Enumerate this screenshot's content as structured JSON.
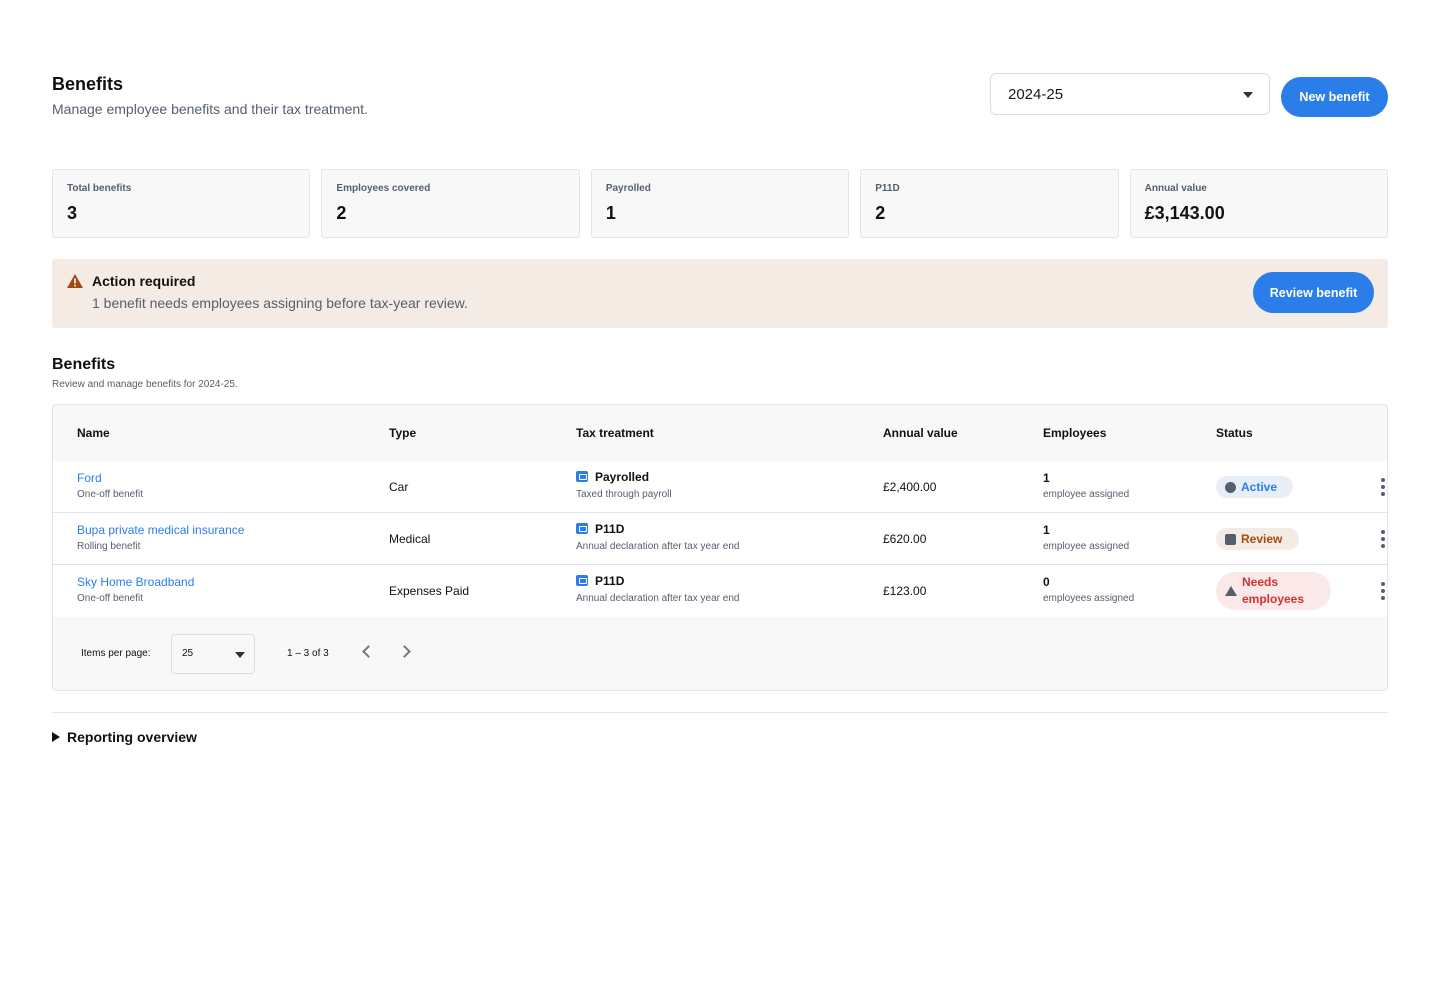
{
  "header": {
    "title": "Benefits",
    "subtitle": "Manage employee benefits and their tax treatment.",
    "tax_year": "2024-25",
    "new_benefit_label": "New benefit"
  },
  "stats": [
    {
      "label": "Total benefits",
      "value": "3"
    },
    {
      "label": "Employees covered",
      "value": "2"
    },
    {
      "label": "Payrolled",
      "value": "1"
    },
    {
      "label": "P11D",
      "value": "2"
    },
    {
      "label": "Annual value",
      "value": "£3,143.00"
    }
  ],
  "alert": {
    "title": "Action required",
    "text": "1 benefit needs employees assigning before tax-year review.",
    "button_label": "Review benefit"
  },
  "section": {
    "title": "Benefits",
    "subtitle": "Review and manage benefits for 2024-25."
  },
  "table": {
    "columns": [
      "Name",
      "Type",
      "Tax treatment",
      "Annual value",
      "Employees",
      "Status"
    ],
    "rows": [
      {
        "name": "Ford",
        "frequency": "One-off benefit",
        "type": "Car",
        "tax": "Payrolled",
        "tax_desc": "Taxed through payroll",
        "value": "£2,400.00",
        "employees": "1",
        "employees_label": "employee assigned",
        "status": "Active"
      },
      {
        "name": "Bupa private medical insurance",
        "frequency": "Rolling benefit",
        "type": "Medical",
        "tax": "P11D",
        "tax_desc": "Annual declaration after tax year end",
        "value": "£620.00",
        "employees": "1",
        "employees_label": "employee assigned",
        "status": "Review"
      },
      {
        "name": "Sky Home Broadband",
        "frequency": "One-off benefit",
        "type": "Expenses Paid",
        "tax": "P11D",
        "tax_desc": "Annual declaration after tax year end",
        "value": "£123.00",
        "employees": "0",
        "employees_label": "employees assigned",
        "status_line1": "Needs",
        "status_line2": "employees"
      }
    ]
  },
  "pagination": {
    "items_per_page_label": "Items per page:",
    "items_per_page": "25",
    "range": "1 – 3 of 3"
  },
  "reporting": {
    "label": "Reporting overview"
  },
  "colors": {
    "accent": "#2b7de9",
    "alert_bg": "#f4ebe5",
    "danger": "#d13232",
    "warning": "#a14b14"
  }
}
